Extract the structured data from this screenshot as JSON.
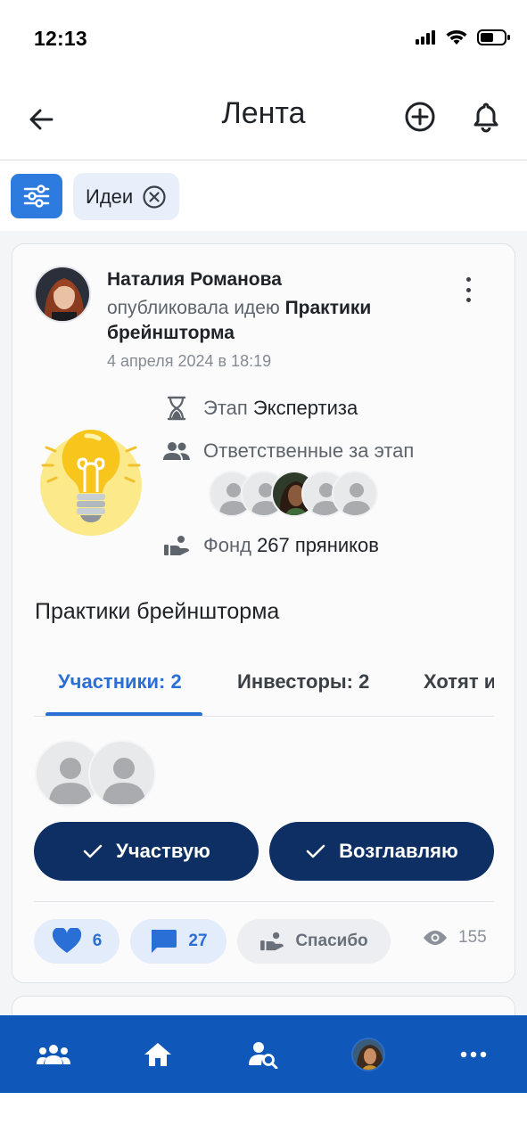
{
  "status_bar": {
    "time": "12:13",
    "icons": [
      "signal-icon",
      "wifi-icon",
      "battery-icon"
    ]
  },
  "header": {
    "title": "Лента",
    "back_icon": "arrow-left-icon",
    "add_icon": "plus-circle-icon",
    "bell_icon": "bell-icon"
  },
  "filters": {
    "filter_icon": "sliders-icon",
    "chip_label": "Идеи",
    "chip_close_icon": "close-circle-icon"
  },
  "post": {
    "author": "Наталия Романова",
    "action_text": "опубликовала идею ",
    "idea_name_bold": "Практики брейншторма",
    "date": "4 апреля 2024 в 18:19",
    "stage_label": "Этап ",
    "stage_value": "Экспертиза",
    "responsible_label": "Ответственные за этап",
    "fund_label": "Фонд ",
    "fund_value": "267 пряников",
    "idea_title": "Практики брейншторма",
    "tabs": [
      {
        "label": "Участники: 2"
      },
      {
        "label": "Инвесторы: 2"
      },
      {
        "label": "Хотят и"
      }
    ],
    "buttons": {
      "participate": "Участвую",
      "lead": "Возглавляю"
    },
    "reactions": {
      "likes": "6",
      "comments": "27",
      "thanks": "Спасибо",
      "views": "155"
    }
  },
  "bottom_nav": {
    "items": [
      "team-icon",
      "home-icon",
      "search-user-icon",
      "profile-avatar",
      "more-icon"
    ]
  },
  "colors": {
    "accent": "#2a6fd6",
    "primary_button": "#0d2f63",
    "bottom_nav": "#0f57b8",
    "filter_button": "#2e7be0"
  }
}
